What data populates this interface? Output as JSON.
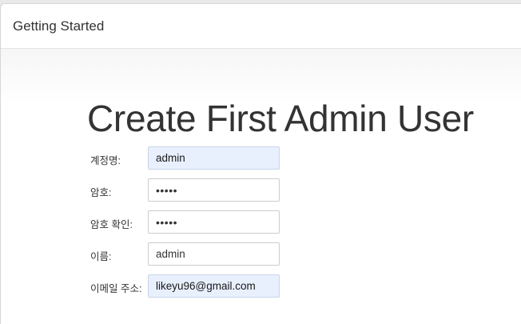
{
  "header": {
    "title": "Getting Started"
  },
  "page": {
    "title": "Create First Admin User"
  },
  "form": {
    "username": {
      "label": "계정명:",
      "value": "admin"
    },
    "password": {
      "label": "암호:",
      "value": "•••••"
    },
    "password_confirm": {
      "label": "암호 확인:",
      "value": "•••••"
    },
    "full_name": {
      "label": "이름:",
      "value": "admin"
    },
    "email": {
      "label": "이메일 주소:",
      "value": "likeyu96@gmail.com"
    }
  },
  "colors": {
    "autofill_background": "#e8f0fe",
    "text": "#333333",
    "border": "#cccccc"
  }
}
